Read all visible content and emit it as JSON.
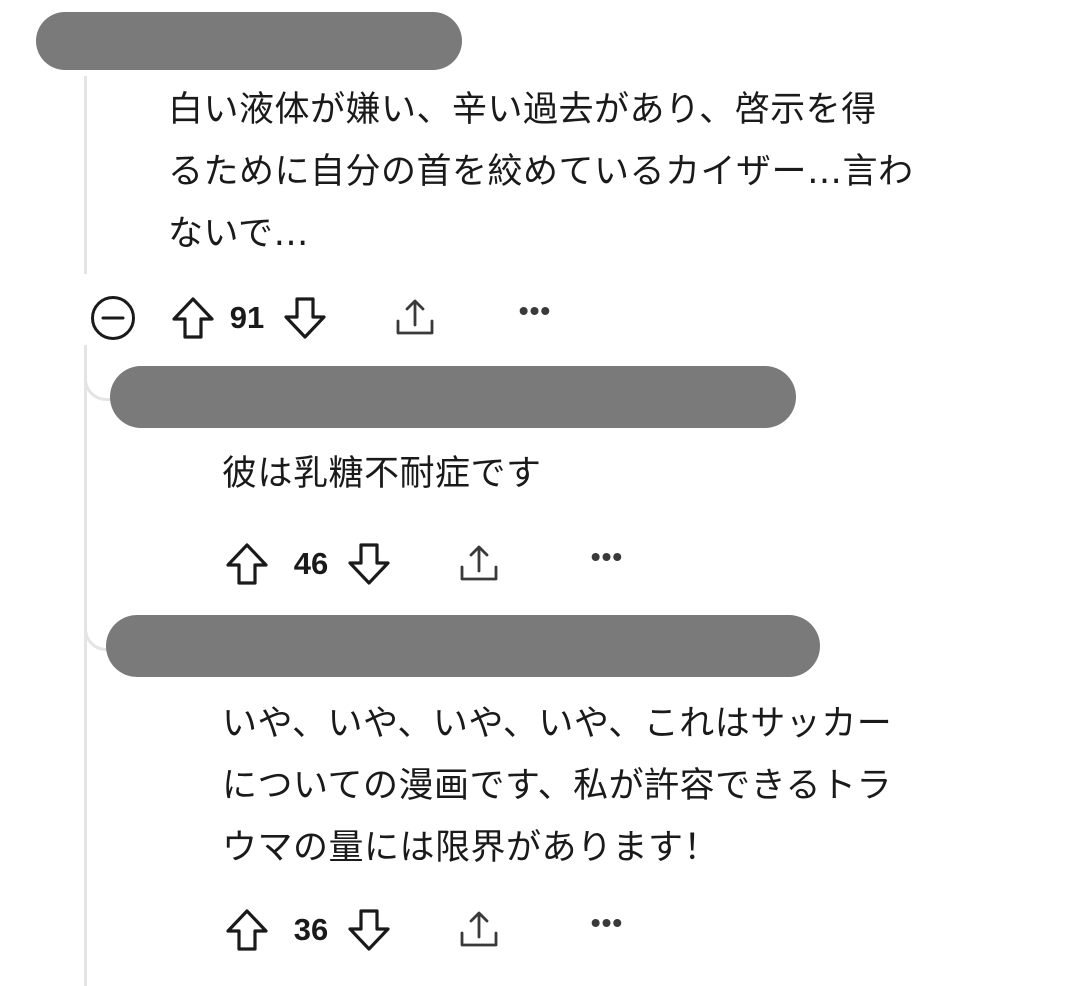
{
  "comments": [
    {
      "text": "白い液体が嫌い、辛い過去があり、啓示を得\nるために自分の首を絞めているカイザー…言わ\nないで…",
      "votes": "91"
    },
    {
      "text": "彼は乳糖不耐症です",
      "votes": "46"
    },
    {
      "text": "いや、いや、いや、いや、これはサッカー\nについての漫画です、私が許容できるトラ\nウマの量には限界があります！",
      "votes": "36"
    }
  ],
  "icons": {
    "collapse": "collapse-thread-icon",
    "upvote": "upvote-arrow-icon",
    "downvote": "downvote-arrow-icon",
    "share": "share-icon",
    "more": "more-options-icon",
    "more_glyph": "•••"
  },
  "colors": {
    "redaction": "#7a7a7a",
    "thread_line": "#e4e4e4",
    "text": "#1a1a1b"
  }
}
